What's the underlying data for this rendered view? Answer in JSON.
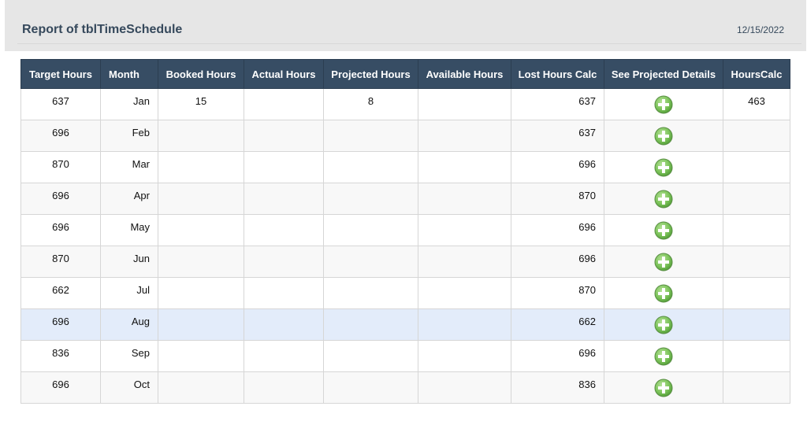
{
  "header": {
    "title": "Report of tblTimeSchedule",
    "date": "12/15/2022"
  },
  "table": {
    "columns": [
      "Target Hours",
      "Month",
      "Booked Hours",
      "Actual Hours",
      "Projected Hours",
      "Available Hours",
      "Lost Hours Calc",
      "See Projected Details",
      "HoursCalc"
    ],
    "rows": [
      {
        "target_hours": "637",
        "month": "Jan",
        "booked_hours": "15",
        "actual_hours": "",
        "projected_hours": "8",
        "available_hours": "",
        "lost_hours_calc": "637",
        "hours_calc": "463"
      },
      {
        "target_hours": "696",
        "month": "Feb",
        "booked_hours": "",
        "actual_hours": "",
        "projected_hours": "",
        "available_hours": "",
        "lost_hours_calc": "637",
        "hours_calc": ""
      },
      {
        "target_hours": "870",
        "month": "Mar",
        "booked_hours": "",
        "actual_hours": "",
        "projected_hours": "",
        "available_hours": "",
        "lost_hours_calc": "696",
        "hours_calc": ""
      },
      {
        "target_hours": "696",
        "month": "Apr",
        "booked_hours": "",
        "actual_hours": "",
        "projected_hours": "",
        "available_hours": "",
        "lost_hours_calc": "870",
        "hours_calc": ""
      },
      {
        "target_hours": "696",
        "month": "May",
        "booked_hours": "",
        "actual_hours": "",
        "projected_hours": "",
        "available_hours": "",
        "lost_hours_calc": "696",
        "hours_calc": ""
      },
      {
        "target_hours": "870",
        "month": "Jun",
        "booked_hours": "",
        "actual_hours": "",
        "projected_hours": "",
        "available_hours": "",
        "lost_hours_calc": "696",
        "hours_calc": ""
      },
      {
        "target_hours": "662",
        "month": "Jul",
        "booked_hours": "",
        "actual_hours": "",
        "projected_hours": "",
        "available_hours": "",
        "lost_hours_calc": "870",
        "hours_calc": ""
      },
      {
        "target_hours": "696",
        "month": "Aug",
        "booked_hours": "",
        "actual_hours": "",
        "projected_hours": "",
        "available_hours": "",
        "lost_hours_calc": "662",
        "hours_calc": ""
      },
      {
        "target_hours": "836",
        "month": "Sep",
        "booked_hours": "",
        "actual_hours": "",
        "projected_hours": "",
        "available_hours": "",
        "lost_hours_calc": "696",
        "hours_calc": ""
      },
      {
        "target_hours": "696",
        "month": "Oct",
        "booked_hours": "",
        "actual_hours": "",
        "projected_hours": "",
        "available_hours": "",
        "lost_hours_calc": "836",
        "hours_calc": ""
      }
    ],
    "selected_row": "Aug",
    "details_icon": "plus-circle-icon"
  },
  "colors": {
    "header_bg": "#374d64",
    "title_color": "#36495c",
    "selected_row_bg": "#e3ecfa",
    "icon_green": "#7cc35a"
  }
}
